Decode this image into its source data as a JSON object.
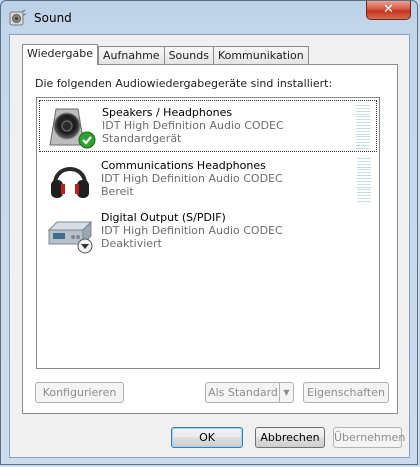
{
  "window": {
    "title": "Sound",
    "close_label": "✕"
  },
  "tabs": [
    {
      "label": "Wiedergabe",
      "active": true
    },
    {
      "label": "Aufnahme",
      "active": false
    },
    {
      "label": "Sounds",
      "active": false
    },
    {
      "label": "Kommunikation",
      "active": false
    }
  ],
  "panel": {
    "caption": "Die folgenden Audiowiedergabegeräte sind installiert:"
  },
  "devices": [
    {
      "name": "Speakers / Headphones",
      "driver": "IDT High Definition Audio CODEC",
      "status": "Standardgerät",
      "icon": "speaker-icon",
      "badge": "default-check-icon"
    },
    {
      "name": "Communications Headphones",
      "driver": "IDT High Definition Audio CODEC",
      "status": "Bereit",
      "icon": "headphones-icon"
    },
    {
      "name": "Digital Output (S/PDIF)",
      "driver": "IDT High Definition Audio CODEC",
      "status": "Deaktiviert",
      "icon": "digital-output-icon",
      "badge": "disabled-arrow-icon"
    }
  ],
  "panel_buttons": {
    "configure": "Konfigurieren",
    "set_default": "Als Standard",
    "properties": "Eigenschaften"
  },
  "dialog_buttons": {
    "ok": "OK",
    "cancel": "Abbrechen",
    "apply": "Übernehmen"
  },
  "colors": {
    "accent": "#3c7fb1",
    "default_check": "#2ea12e",
    "meter": "#c5dde3"
  }
}
